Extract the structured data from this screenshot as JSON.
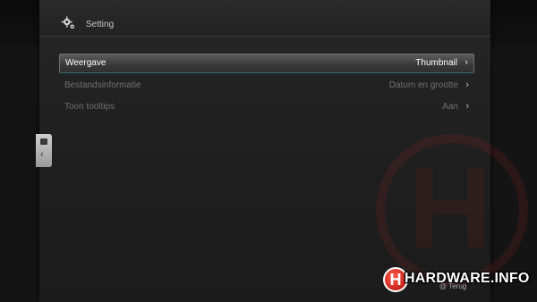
{
  "header": {
    "title": "Setting",
    "icon": "gear-icon"
  },
  "settings": [
    {
      "label": "Weergave",
      "value": "Thumbnail",
      "selected": true
    },
    {
      "label": "Bestandsinformatie",
      "value": "Datum en grootte",
      "selected": false
    },
    {
      "label": "Toon tooltips",
      "value": "Aan",
      "selected": false
    }
  ],
  "side_tab": {
    "icon": "tab-icon",
    "arrow": "chevron-left-icon"
  },
  "watermark": {
    "letter": "H"
  },
  "logo": {
    "letter": "H",
    "text": "HARDWARE.INFO"
  },
  "footer": {
    "hint": "@ Terug"
  },
  "colors": {
    "accent": "#3e6a78",
    "selected_text": "#ffffff",
    "inactive_text": "#6f6f6f"
  }
}
